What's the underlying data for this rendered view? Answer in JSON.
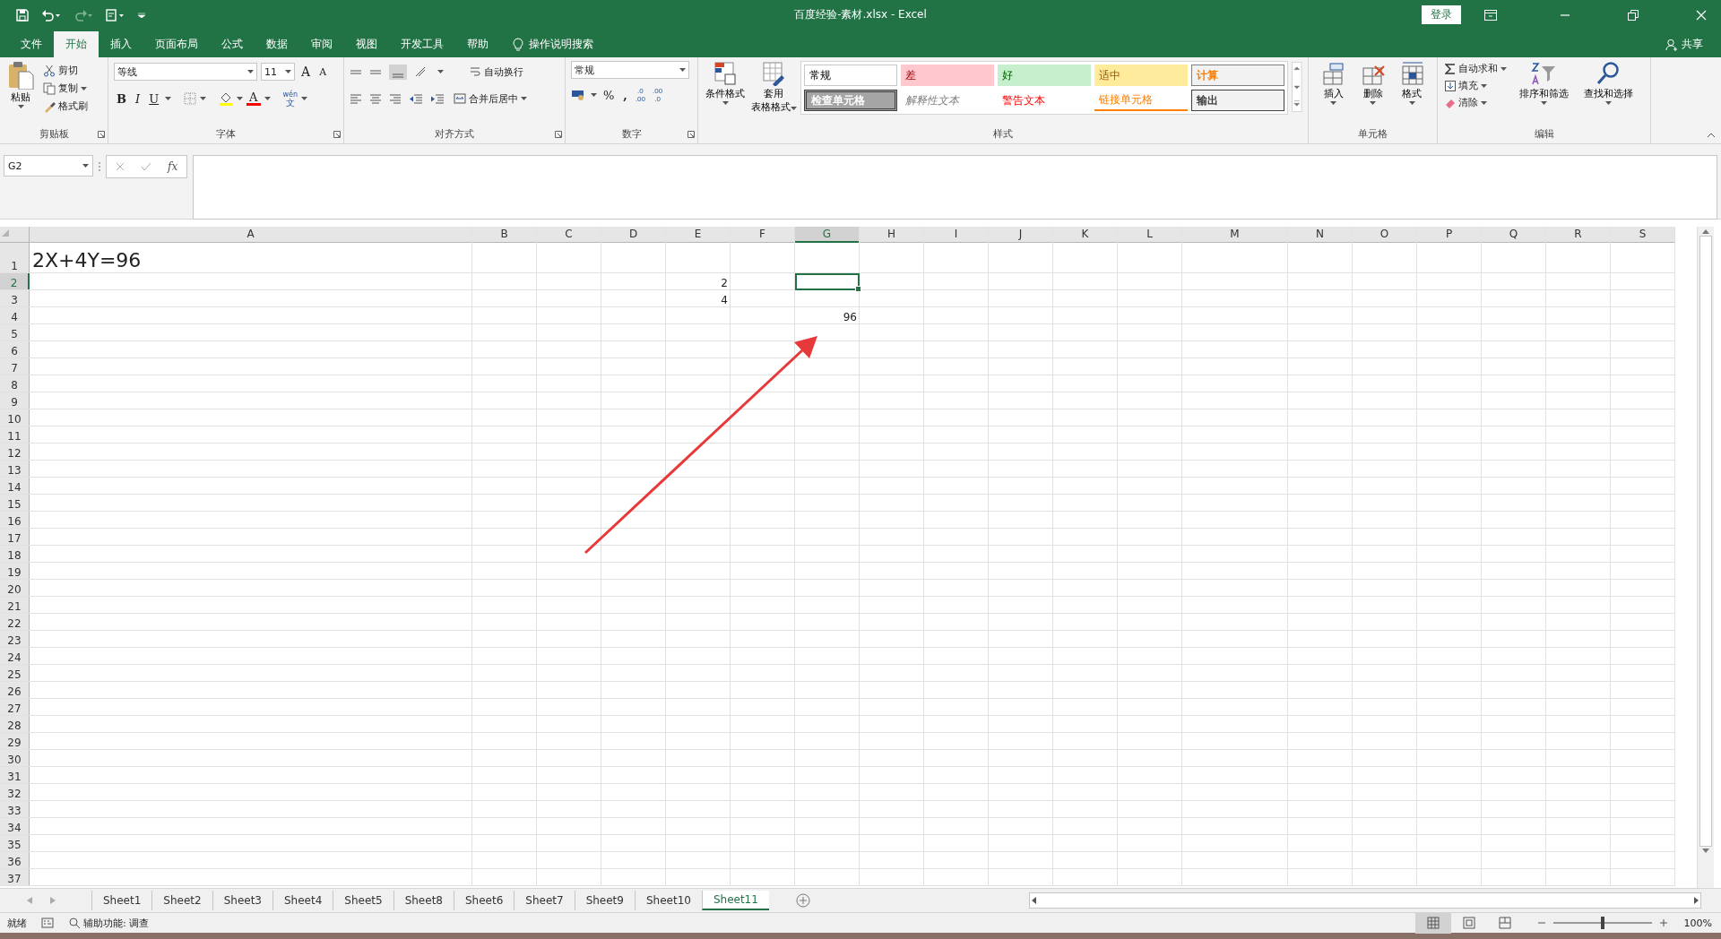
{
  "window": {
    "title": "百度经验-素材.xlsx  -  Excel",
    "login": "登录",
    "share": "共享"
  },
  "ribbon_tabs": [
    {
      "label": "文件",
      "selected": false
    },
    {
      "label": "开始",
      "selected": true
    },
    {
      "label": "插入",
      "selected": false
    },
    {
      "label": "页面布局",
      "selected": false
    },
    {
      "label": "公式",
      "selected": false
    },
    {
      "label": "数据",
      "selected": false
    },
    {
      "label": "审阅",
      "selected": false
    },
    {
      "label": "视图",
      "selected": false
    },
    {
      "label": "开发工具",
      "selected": false
    },
    {
      "label": "帮助",
      "selected": false
    }
  ],
  "tell_me": "操作说明搜索",
  "clipboard": {
    "paste": "粘贴",
    "cut": "剪切",
    "copy": "复制",
    "format_painter": "格式刷",
    "label": "剪贴板"
  },
  "font": {
    "name": "等线",
    "size": "11",
    "grow": "A",
    "shrink": "A",
    "bold": "B",
    "italic": "I",
    "underline": "U",
    "font_color": "A",
    "phonetic_top": "wén",
    "phonetic_bottom": "文",
    "label": "字体"
  },
  "alignment": {
    "wrap": "自动换行",
    "merge": "合并后居中",
    "label": "对齐方式"
  },
  "number": {
    "format": "常规",
    "percent": "%",
    "comma": ",",
    "decimal_buttons": [
      {
        "top": ".0",
        "bottom": ".00"
      },
      {
        "top": ".00",
        "bottom": ".0"
      }
    ],
    "label": "数字"
  },
  "styles": {
    "conditional": "条件格式",
    "table_top": "套用",
    "table_bottom": "表格格式",
    "label": "样式",
    "gallery": [
      {
        "label": "常规",
        "kind": "normal"
      },
      {
        "label": "差",
        "kind": "bad"
      },
      {
        "label": "好",
        "kind": "good"
      },
      {
        "label": "适中",
        "kind": "neutral"
      },
      {
        "label": "计算",
        "kind": "calculation"
      },
      {
        "label": "检查单元格",
        "kind": "check"
      },
      {
        "label": "解释性文本",
        "kind": "explanatory"
      },
      {
        "label": "警告文本",
        "kind": "warning"
      },
      {
        "label": "链接单元格",
        "kind": "linked"
      },
      {
        "label": "输出",
        "kind": "output"
      }
    ]
  },
  "cells_group": {
    "buttons": [
      "插入",
      "删除",
      "格式"
    ],
    "label": "单元格"
  },
  "editing": {
    "autosum": "自动求和",
    "fill": "填充",
    "clear": "清除",
    "sort": "排序和筛选",
    "find": "查找和选择",
    "label": "编辑"
  },
  "formula_bar": {
    "name_box": "G2",
    "fx": "fx"
  },
  "columns": [
    {
      "label": "A",
      "selected": false
    },
    {
      "label": "B",
      "selected": false
    },
    {
      "label": "C",
      "selected": false
    },
    {
      "label": "D",
      "selected": false
    },
    {
      "label": "E",
      "selected": false
    },
    {
      "label": "F",
      "selected": false
    },
    {
      "label": "G",
      "selected": true
    },
    {
      "label": "H",
      "selected": false
    },
    {
      "label": "I",
      "selected": false
    },
    {
      "label": "J",
      "selected": false
    },
    {
      "label": "K",
      "selected": false
    },
    {
      "label": "L",
      "selected": false
    },
    {
      "label": "M",
      "selected": false
    },
    {
      "label": "N",
      "selected": false
    },
    {
      "label": "O",
      "selected": false
    },
    {
      "label": "P",
      "selected": false
    },
    {
      "label": "Q",
      "selected": false
    },
    {
      "label": "R",
      "selected": false
    },
    {
      "label": "S",
      "selected": false
    }
  ],
  "rows": [
    {
      "header": "1",
      "selected": false,
      "cells": [
        {
          "text": "2X+4Y=96",
          "kind": "large"
        }
      ]
    },
    {
      "header": "2",
      "selected": true,
      "cells": [
        null,
        null,
        null,
        null,
        {
          "text": "2",
          "kind": "number"
        }
      ]
    },
    {
      "header": "3",
      "selected": false,
      "cells": [
        null,
        null,
        null,
        null,
        {
          "text": "4",
          "kind": "number"
        }
      ]
    },
    {
      "header": "4",
      "selected": false,
      "cells": [
        null,
        null,
        null,
        null,
        null,
        null,
        {
          "text": "96",
          "kind": "number"
        }
      ]
    },
    {
      "header": "5",
      "selected": false
    },
    {
      "header": "6",
      "selected": false
    },
    {
      "header": "7",
      "selected": false
    },
    {
      "header": "8",
      "selected": false
    },
    {
      "header": "9",
      "selected": false
    },
    {
      "header": "10",
      "selected": false
    },
    {
      "header": "11",
      "selected": false
    },
    {
      "header": "12",
      "selected": false
    },
    {
      "header": "13",
      "selected": false
    },
    {
      "header": "14",
      "selected": false
    },
    {
      "header": "15",
      "selected": false
    },
    {
      "header": "16",
      "selected": false
    },
    {
      "header": "17",
      "selected": false
    },
    {
      "header": "18",
      "selected": false
    },
    {
      "header": "19",
      "selected": false
    },
    {
      "header": "20",
      "selected": false
    },
    {
      "header": "21",
      "selected": false
    },
    {
      "header": "22",
      "selected": false
    },
    {
      "header": "23",
      "selected": false
    },
    {
      "header": "24",
      "selected": false
    },
    {
      "header": "25",
      "selected": false
    },
    {
      "header": "26",
      "selected": false
    },
    {
      "header": "27",
      "selected": false
    },
    {
      "header": "28",
      "selected": false
    },
    {
      "header": "29",
      "selected": false
    },
    {
      "header": "30",
      "selected": false
    },
    {
      "header": "31",
      "selected": false
    },
    {
      "header": "32",
      "selected": false
    },
    {
      "header": "33",
      "selected": false
    },
    {
      "header": "34",
      "selected": false
    },
    {
      "header": "35",
      "selected": false
    },
    {
      "header": "36",
      "selected": false
    },
    {
      "header": "37",
      "selected": false
    }
  ],
  "sheet_tabs": [
    {
      "label": "Sheet1",
      "selected": false
    },
    {
      "label": "Sheet2",
      "selected": false
    },
    {
      "label": "Sheet3",
      "selected": false
    },
    {
      "label": "Sheet4",
      "selected": false
    },
    {
      "label": "Sheet5",
      "selected": false
    },
    {
      "label": "Sheet8",
      "selected": false
    },
    {
      "label": "Sheet6",
      "selected": false
    },
    {
      "label": "Sheet7",
      "selected": false
    },
    {
      "label": "Sheet9",
      "selected": false
    },
    {
      "label": "Sheet10",
      "selected": false
    },
    {
      "label": "Sheet11",
      "selected": true
    }
  ],
  "status_bar": {
    "ready": "就绪",
    "accessibility": "辅助功能: 调查",
    "views": [
      {
        "kind": "normal",
        "selected": true
      },
      {
        "kind": "page_layout",
        "selected": false
      },
      {
        "kind": "page_break",
        "selected": false
      }
    ],
    "zoom_slider": {
      "level": 0.5
    },
    "zoom": "100%"
  }
}
